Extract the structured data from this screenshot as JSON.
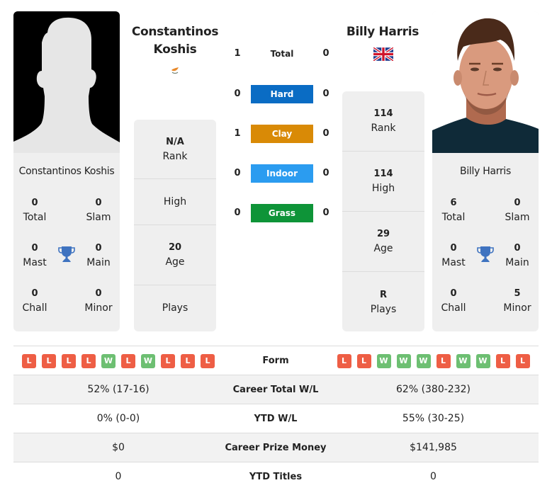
{
  "colors": {
    "hard": "#0a6cc4",
    "clay": "#d98a06",
    "indoor": "#2b9cf0",
    "grass": "#0e9438",
    "win": "#6dbf72",
    "loss": "#ee5e45",
    "trophy": "#3f73c0",
    "card_bg": "#efefef"
  },
  "player1": {
    "name_line1": "Constantinos",
    "name_line2": "Koshis",
    "full_name": "Constantinos Koshis",
    "flag": "cyprus-flag",
    "photo": "silhouette-placeholder",
    "titles": {
      "total": {
        "value": "0",
        "label": "Total"
      },
      "slam": {
        "value": "0",
        "label": "Slam"
      },
      "mast": {
        "value": "0",
        "label": "Mast"
      },
      "main": {
        "value": "0",
        "label": "Main"
      },
      "chall": {
        "value": "0",
        "label": "Chall"
      },
      "minor": {
        "value": "0",
        "label": "Minor"
      }
    },
    "info": {
      "rank": {
        "value": "N/A",
        "label": "Rank"
      },
      "high": {
        "value": "",
        "label": "High"
      },
      "age": {
        "value": "20",
        "label": "Age"
      },
      "plays": {
        "value": "",
        "label": "Plays"
      }
    },
    "form": [
      "L",
      "L",
      "L",
      "L",
      "W",
      "L",
      "W",
      "L",
      "L",
      "L"
    ]
  },
  "player2": {
    "name": "Billy Harris",
    "full_name": "Billy Harris",
    "flag": "uk-flag",
    "photo": "player-headshot",
    "titles": {
      "total": {
        "value": "6",
        "label": "Total"
      },
      "slam": {
        "value": "0",
        "label": "Slam"
      },
      "mast": {
        "value": "0",
        "label": "Mast"
      },
      "main": {
        "value": "0",
        "label": "Main"
      },
      "chall": {
        "value": "0",
        "label": "Chall"
      },
      "minor": {
        "value": "5",
        "label": "Minor"
      }
    },
    "info": {
      "rank": {
        "value": "114",
        "label": "Rank"
      },
      "high": {
        "value": "114",
        "label": "High"
      },
      "age": {
        "value": "29",
        "label": "Age"
      },
      "plays": {
        "value": "R",
        "label": "Plays"
      }
    },
    "form": [
      "L",
      "L",
      "W",
      "W",
      "W",
      "L",
      "W",
      "W",
      "L",
      "L"
    ]
  },
  "h2h": [
    {
      "label": "Total",
      "left": "1",
      "right": "0",
      "surface": "total"
    },
    {
      "label": "Hard",
      "left": "0",
      "right": "0",
      "surface": "hard"
    },
    {
      "label": "Clay",
      "left": "1",
      "right": "0",
      "surface": "clay"
    },
    {
      "label": "Indoor",
      "left": "0",
      "right": "0",
      "surface": "indoor"
    },
    {
      "label": "Grass",
      "left": "0",
      "right": "0",
      "surface": "grass"
    }
  ],
  "comparison": {
    "form_label": "Form",
    "rows": [
      {
        "label": "Career Total W/L",
        "left": "52% (17-16)",
        "right": "62% (380-232)"
      },
      {
        "label": "YTD W/L",
        "left": "0% (0-0)",
        "right": "55% (30-25)"
      },
      {
        "label": "Career Prize Money",
        "left": "$0",
        "right": "$141,985"
      },
      {
        "label": "YTD Titles",
        "left": "0",
        "right": "0"
      }
    ]
  }
}
